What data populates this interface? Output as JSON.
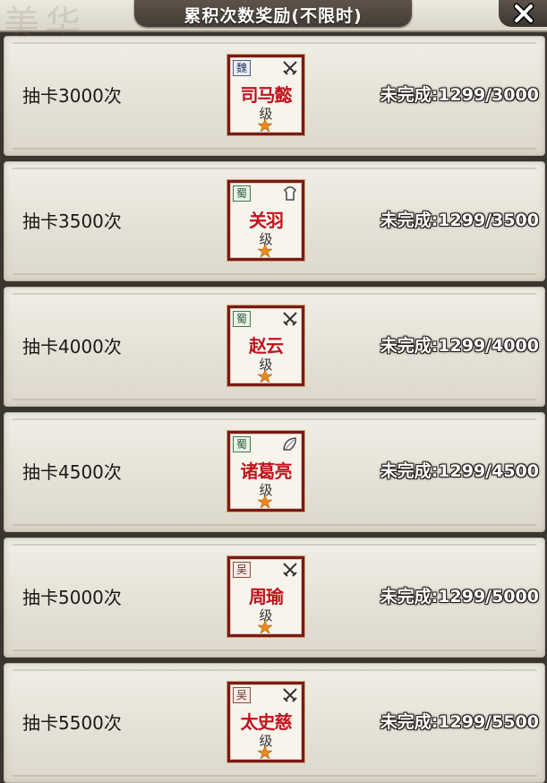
{
  "header": {
    "title": "累积次数奖励(不限时)",
    "background_text": "美华",
    "close_icon": "close-icon"
  },
  "rewards": [
    {
      "label": "抽卡3000次",
      "faction": "魏",
      "faction_key": "wei",
      "weapon_icon": "crossed-swords-icon",
      "hero": "司马懿",
      "grade": "级",
      "status": "未完成:1299/3000"
    },
    {
      "label": "抽卡3500次",
      "faction": "蜀",
      "faction_key": "shu",
      "weapon_icon": "armor-icon",
      "hero": "关羽",
      "grade": "级",
      "status": "未完成:1299/3500"
    },
    {
      "label": "抽卡4000次",
      "faction": "蜀",
      "faction_key": "shu",
      "weapon_icon": "crossed-swords-icon",
      "hero": "赵云",
      "grade": "级",
      "status": "未完成:1299/4000"
    },
    {
      "label": "抽卡4500次",
      "faction": "蜀",
      "faction_key": "shu",
      "weapon_icon": "fan-icon",
      "hero": "诸葛亮",
      "grade": "级",
      "status": "未完成:1299/4500"
    },
    {
      "label": "抽卡5000次",
      "faction": "吴",
      "faction_key": "wu",
      "weapon_icon": "crossed-swords-icon",
      "hero": "周瑜",
      "grade": "级",
      "status": "未完成:1299/5000"
    },
    {
      "label": "抽卡5500次",
      "faction": "吴",
      "faction_key": "wu",
      "weapon_icon": "crossed-swords-icon",
      "hero": "太史慈",
      "grade": "级",
      "status": "未完成:1299/5500"
    }
  ],
  "colors": {
    "hero_name": "#c0121a",
    "frame": "#7a1a1a",
    "star": "#e98b1d"
  }
}
